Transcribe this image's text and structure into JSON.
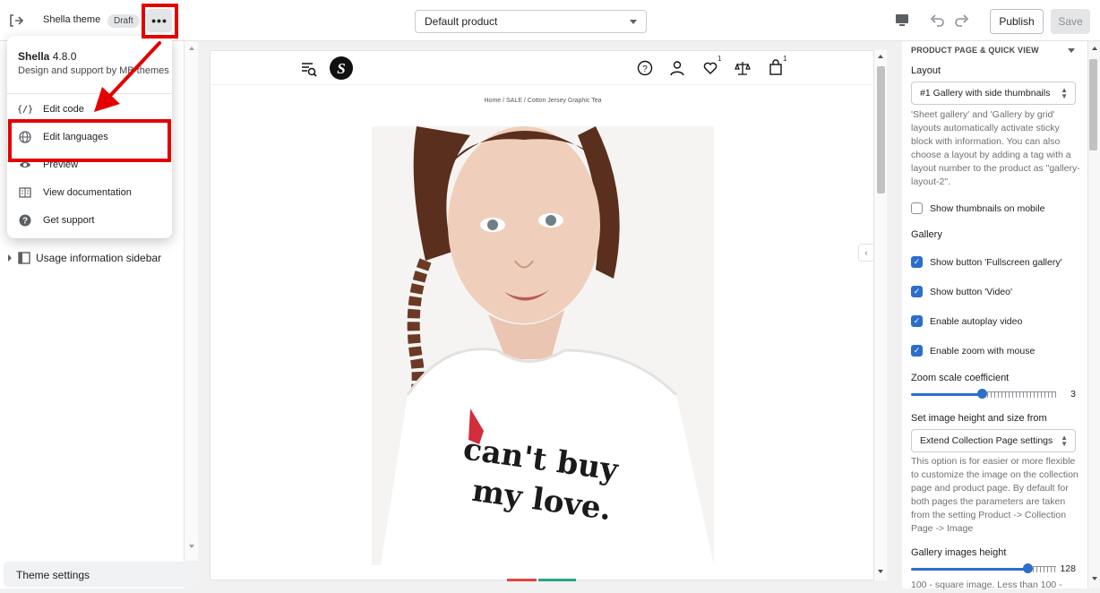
{
  "topbar": {
    "theme_name": "Shella theme",
    "status_badge": "Draft",
    "more_label": "•••",
    "product_select": "Default product",
    "publish_label": "Publish",
    "save_label": "Save"
  },
  "menu": {
    "app_name": "Shella",
    "version": "4.8.0",
    "support_text": "Design and support by MB themes",
    "items": [
      {
        "label": "Edit code",
        "icon": "code-icon"
      },
      {
        "label": "Edit languages",
        "icon": "globe-icon"
      },
      {
        "label": "Preview",
        "icon": "eye-icon"
      },
      {
        "label": "View documentation",
        "icon": "book-icon"
      },
      {
        "label": "Get support",
        "icon": "question-icon"
      }
    ]
  },
  "left_panel": {
    "usage_sidebar": "Usage information sidebar",
    "theme_settings": "Theme settings"
  },
  "preview": {
    "breadcrumb": "Home  /  SALE  /  Cotton Jersey Graphic Tea",
    "wishlist_count": "1",
    "cart_count": "1",
    "shirt_text_line1": "can't buy",
    "shirt_text_line2": "my love."
  },
  "right_panel": {
    "section_title": "PRODUCT PAGE & QUICK VIEW",
    "layout_label": "Layout",
    "layout_value": "#1 Gallery with side thumbnails",
    "layout_help": "'Sheet gallery' and 'Gallery by grid' layouts automatically activate sticky block with information. You can also choose a layout by adding a tag with a layout number to the product as \"gallery-layout-2\".",
    "show_thumbnails_mobile": "Show thumbnails on mobile",
    "gallery_label": "Gallery",
    "checks": [
      {
        "label": "Show button 'Fullscreen gallery'",
        "checked": true
      },
      {
        "label": "Show button 'Video'",
        "checked": true
      },
      {
        "label": "Enable autoplay video",
        "checked": true
      },
      {
        "label": "Enable zoom with mouse",
        "checked": true
      }
    ],
    "zoom_label": "Zoom scale coefficient",
    "zoom_value": "3",
    "zoom_fraction": 0.49,
    "image_size_label": "Set image height and size from",
    "image_size_value": "Extend Collection Page settings",
    "image_size_help": "This option is for easier or more flexible to customize the image on the collection page and product page. By default for both pages the parameters are taken from the setting Product -> Collection Page -> Image",
    "gallery_height_label": "Gallery images height",
    "gallery_height_value": "128",
    "gallery_height_fraction": 0.8,
    "gallery_height_help": "100 - square image. Less than 100 -"
  },
  "colors": {
    "accent": "#2c6ecb",
    "highlight": "#e50000"
  }
}
